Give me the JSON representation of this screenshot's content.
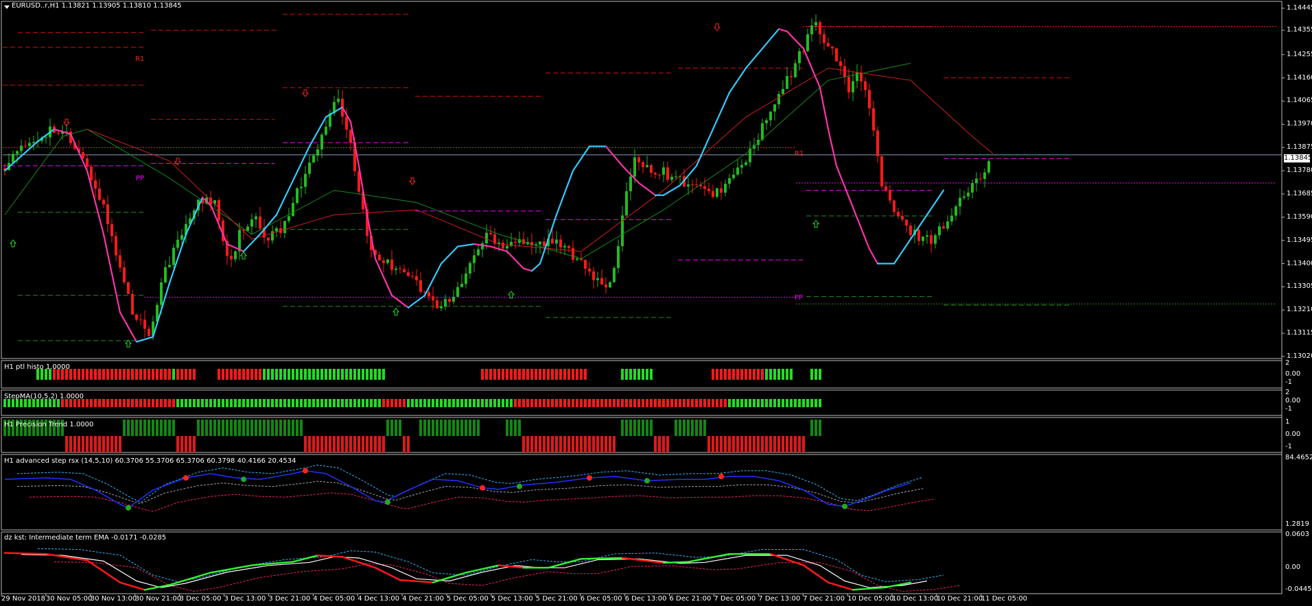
{
  "header": {
    "symbol_info": "EURUSD..r,H1  1.13821 1.13905 1.13810 1.13845"
  },
  "current_price": "1.13845",
  "price_axis": [
    "1.14445",
    "1.14355",
    "1.14255",
    "1.14160",
    "1.14065",
    "1.13970",
    "1.13875",
    "1.13780",
    "1.13685",
    "1.13590",
    "1.13495",
    "1.13400",
    "1.13305",
    "1.13210",
    "1.13115",
    "1.13020"
  ],
  "pivot_labels": [
    {
      "text": "R1",
      "color": "#ff2020"
    },
    {
      "text": "PP",
      "color": "#ff00ff"
    },
    {
      "text": "R1",
      "color": "#ff2020"
    },
    {
      "text": "PP",
      "color": "#ff00ff"
    }
  ],
  "subpanels": [
    {
      "title": "H1 ptl histo 1.0000",
      "scale": [
        "2",
        "0.00",
        "-1"
      ]
    },
    {
      "title": "StepMA(10,5,2) 1.0000",
      "scale": [
        "2",
        "0.00",
        "-1"
      ]
    },
    {
      "title": "H1 Precision Trend 1.0000",
      "scale": [
        "1",
        "0.00",
        "-1"
      ]
    },
    {
      "title": "H1 advanced step rsx (14,5,10) 60.3706 55.3706 65.3706 60.3798 40.4166 20.4534",
      "scale": [
        "84.4652",
        "1.2819"
      ]
    },
    {
      "title": "dz kst: Intermediate term EMA -0.0171 -0.0285",
      "scale": [
        "0.0603",
        "0.00",
        "-0.0445"
      ]
    }
  ],
  "time_axis": [
    "29 Nov 2018",
    "30 Nov 05:00",
    "30 Nov 13:00",
    "30 Nov 21:00",
    "3 Dec 05:00",
    "3 Dec 13:00",
    "3 Dec 21:00",
    "4 Dec 05:00",
    "4 Dec 13:00",
    "4 Dec 21:00",
    "5 Dec 05:00",
    "5 Dec 13:00",
    "5 Dec 21:00",
    "6 Dec 05:00",
    "6 Dec 13:00",
    "6 Dec 21:00",
    "7 Dec 05:00",
    "7 Dec 13:00",
    "7 Dec 21:00",
    "10 Dec 05:00",
    "10 Dec 13:00",
    "10 Dec 21:00",
    "11 Dec 05:00"
  ],
  "chart_data": {
    "type": "candlestick",
    "symbol": "EURUSD..r",
    "timeframe": "H1",
    "last_bar": {
      "open": 1.13821,
      "high": 1.13905,
      "low": 1.1381,
      "close": 1.13845
    },
    "ylim": [
      1.1302,
      1.14445
    ],
    "ticks": [
      1.14445,
      1.14355,
      1.14255,
      1.1416,
      1.14065,
      1.1397,
      1.13875,
      1.1378,
      1.13685,
      1.1359,
      1.13495,
      1.134,
      1.13305,
      1.1321,
      1.13115,
      1.1302
    ],
    "close_path": [
      [
        0,
        1.1379
      ],
      [
        6,
        1.1388
      ],
      [
        12,
        1.1395
      ],
      [
        16,
        1.1392
      ],
      [
        20,
        1.1382
      ],
      [
        24,
        1.1368
      ],
      [
        28,
        1.1345
      ],
      [
        32,
        1.132
      ],
      [
        36,
        1.1312
      ],
      [
        38,
        1.1325
      ],
      [
        40,
        1.1338
      ],
      [
        44,
        1.1352
      ],
      [
        48,
        1.1365
      ],
      [
        52,
        1.1366
      ],
      [
        54,
        1.135
      ],
      [
        56,
        1.134
      ],
      [
        58,
        1.1352
      ],
      [
        62,
        1.1358
      ],
      [
        64,
        1.135
      ],
      [
        68,
        1.1353
      ],
      [
        72,
        1.137
      ],
      [
        76,
        1.1383
      ],
      [
        80,
        1.14
      ],
      [
        82,
        1.1408
      ],
      [
        84,
        1.1395
      ],
      [
        86,
        1.138
      ],
      [
        88,
        1.136
      ],
      [
        90,
        1.1345
      ],
      [
        94,
        1.134
      ],
      [
        98,
        1.1338
      ],
      [
        102,
        1.133
      ],
      [
        106,
        1.1322
      ],
      [
        110,
        1.1326
      ],
      [
        114,
        1.134
      ],
      [
        118,
        1.1352
      ],
      [
        122,
        1.1348
      ],
      [
        126,
        1.135
      ],
      [
        130,
        1.1348
      ],
      [
        134,
        1.1349
      ],
      [
        138,
        1.1345
      ],
      [
        142,
        1.134
      ],
      [
        146,
        1.133
      ],
      [
        148,
        1.1332
      ],
      [
        150,
        1.1345
      ],
      [
        152,
        1.137
      ],
      [
        154,
        1.1385
      ],
      [
        156,
        1.138
      ],
      [
        160,
        1.1378
      ],
      [
        164,
        1.1375
      ],
      [
        168,
        1.1372
      ],
      [
        172,
        1.1368
      ],
      [
        176,
        1.1372
      ],
      [
        180,
        1.138
      ],
      [
        184,
        1.1392
      ],
      [
        188,
        1.1405
      ],
      [
        192,
        1.1418
      ],
      [
        196,
        1.1432
      ],
      [
        198,
        1.144
      ],
      [
        200,
        1.1432
      ],
      [
        204,
        1.142
      ],
      [
        206,
        1.1412
      ],
      [
        208,
        1.1418
      ],
      [
        210,
        1.141
      ],
      [
        212,
        1.1395
      ],
      [
        214,
        1.1372
      ],
      [
        218,
        1.1358
      ],
      [
        222,
        1.1352
      ],
      [
        226,
        1.135
      ],
      [
        230,
        1.1358
      ],
      [
        234,
        1.1368
      ],
      [
        238,
        1.1375
      ],
      [
        240,
        1.1384
      ]
    ],
    "fast_line_cyan_magenta": [
      [
        0,
        1.1378
      ],
      [
        8,
        1.139
      ],
      [
        12,
        1.1395
      ],
      [
        16,
        1.1393
      ],
      [
        20,
        1.1378
      ],
      [
        24,
        1.1352
      ],
      [
        28,
        1.132
      ],
      [
        32,
        1.1308
      ],
      [
        36,
        1.131
      ],
      [
        40,
        1.1332
      ],
      [
        44,
        1.1352
      ],
      [
        48,
        1.1367
      ],
      [
        50,
        1.1364
      ],
      [
        54,
        1.1348
      ],
      [
        58,
        1.1345
      ],
      [
        62,
        1.1352
      ],
      [
        66,
        1.136
      ],
      [
        70,
        1.1374
      ],
      [
        74,
        1.1388
      ],
      [
        78,
        1.14
      ],
      [
        82,
        1.1404
      ],
      [
        84,
        1.1398
      ],
      [
        86,
        1.138
      ],
      [
        88,
        1.136
      ],
      [
        90,
        1.1342
      ],
      [
        94,
        1.1327
      ],
      [
        98,
        1.1322
      ],
      [
        102,
        1.1327
      ],
      [
        106,
        1.134
      ],
      [
        110,
        1.1347
      ],
      [
        114,
        1.1348
      ],
      [
        118,
        1.1347
      ],
      [
        122,
        1.1345
      ],
      [
        126,
        1.1338
      ],
      [
        128,
        1.1337
      ],
      [
        130,
        1.134
      ],
      [
        134,
        1.136
      ],
      [
        138,
        1.1378
      ],
      [
        142,
        1.1388
      ],
      [
        146,
        1.1388
      ],
      [
        150,
        1.138
      ],
      [
        154,
        1.1373
      ],
      [
        158,
        1.1368
      ],
      [
        160,
        1.1368
      ],
      [
        164,
        1.1372
      ],
      [
        168,
        1.138
      ],
      [
        172,
        1.1395
      ],
      [
        176,
        1.141
      ],
      [
        180,
        1.142
      ],
      [
        184,
        1.1428
      ],
      [
        188,
        1.1436
      ],
      [
        190,
        1.1435
      ],
      [
        194,
        1.1428
      ],
      [
        198,
        1.1412
      ],
      [
        200,
        1.1395
      ],
      [
        202,
        1.138
      ],
      [
        206,
        1.1363
      ],
      [
        210,
        1.1346
      ],
      [
        212,
        1.134
      ],
      [
        216,
        1.134
      ],
      [
        220,
        1.135
      ],
      [
        224,
        1.136
      ],
      [
        228,
        1.137
      ]
    ],
    "slow_line_green": [
      [
        0,
        1.136
      ],
      [
        14,
        1.1392
      ],
      [
        20,
        1.1395
      ],
      [
        40,
        1.1375
      ],
      [
        60,
        1.1352
      ],
      [
        80,
        1.137
      ],
      [
        100,
        1.1365
      ],
      [
        120,
        1.1352
      ],
      [
        140,
        1.1342
      ],
      [
        160,
        1.1362
      ],
      [
        180,
        1.1385
      ],
      [
        200,
        1.1415
      ],
      [
        220,
        1.1422
      ]
    ],
    "slow_line_red": [
      [
        20,
        1.1395
      ],
      [
        40,
        1.1382
      ],
      [
        60,
        1.135
      ],
      [
        80,
        1.136
      ],
      [
        100,
        1.1362
      ],
      [
        120,
        1.1348
      ],
      [
        140,
        1.1345
      ],
      [
        160,
        1.137
      ],
      [
        180,
        1.14
      ],
      [
        200,
        1.142
      ],
      [
        220,
        1.1415
      ],
      [
        235,
        1.1392
      ],
      [
        240,
        1.1385
      ]
    ]
  }
}
